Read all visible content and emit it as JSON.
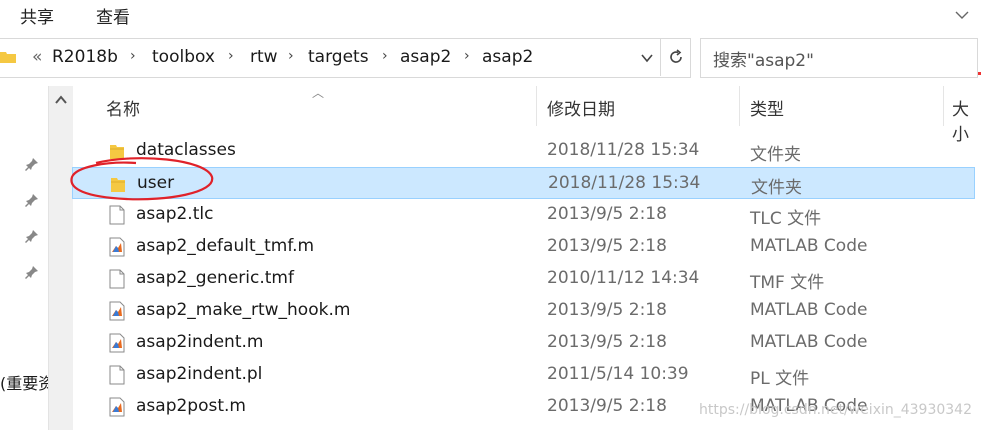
{
  "ribbon": {
    "tabs": [
      "共享",
      "查看"
    ]
  },
  "address": {
    "overflow": "«",
    "breadcrumbs": [
      "R2018b",
      "toolbox",
      "rtw",
      "targets",
      "asap2",
      "asap2"
    ]
  },
  "search": {
    "placeholder": "搜索\"asap2\""
  },
  "columns": {
    "name": "名称",
    "date": "修改日期",
    "type": "类型",
    "size": "大小"
  },
  "files": [
    {
      "name": "dataclasses",
      "date": "2018/11/28 15:34",
      "type": "文件夹",
      "icon": "folder-icon"
    },
    {
      "name": "user",
      "date": "2018/11/28 15:34",
      "type": "文件夹",
      "icon": "folder-icon",
      "selected": true
    },
    {
      "name": "asap2.tlc",
      "date": "2013/9/5 2:18",
      "type": "TLC 文件",
      "icon": "file-icon"
    },
    {
      "name": "asap2_default_tmf.m",
      "date": "2013/9/5 2:18",
      "type": "MATLAB Code",
      "icon": "matlab-file-icon"
    },
    {
      "name": "asap2_generic.tmf",
      "date": "2010/11/12 14:34",
      "type": "TMF 文件",
      "icon": "file-icon"
    },
    {
      "name": "asap2_make_rtw_hook.m",
      "date": "2013/9/5 2:18",
      "type": "MATLAB Code",
      "icon": "matlab-file-icon"
    },
    {
      "name": "asap2indent.m",
      "date": "2013/9/5 2:18",
      "type": "MATLAB Code",
      "icon": "matlab-file-icon"
    },
    {
      "name": "asap2indent.pl",
      "date": "2011/5/14 10:39",
      "type": "PL 文件",
      "icon": "file-icon"
    },
    {
      "name": "asap2post.m",
      "date": "2013/9/5 2:18",
      "type": "MATLAB Code",
      "icon": "matlab-file-icon"
    }
  ],
  "sidebar": {
    "partial_text": "(重要资"
  },
  "watermark": "https://blog.csdn.net/weixin_43930342",
  "colors": {
    "selection": "#cce8ff",
    "annotation": "#e0222a",
    "folder": "#f5c842"
  }
}
